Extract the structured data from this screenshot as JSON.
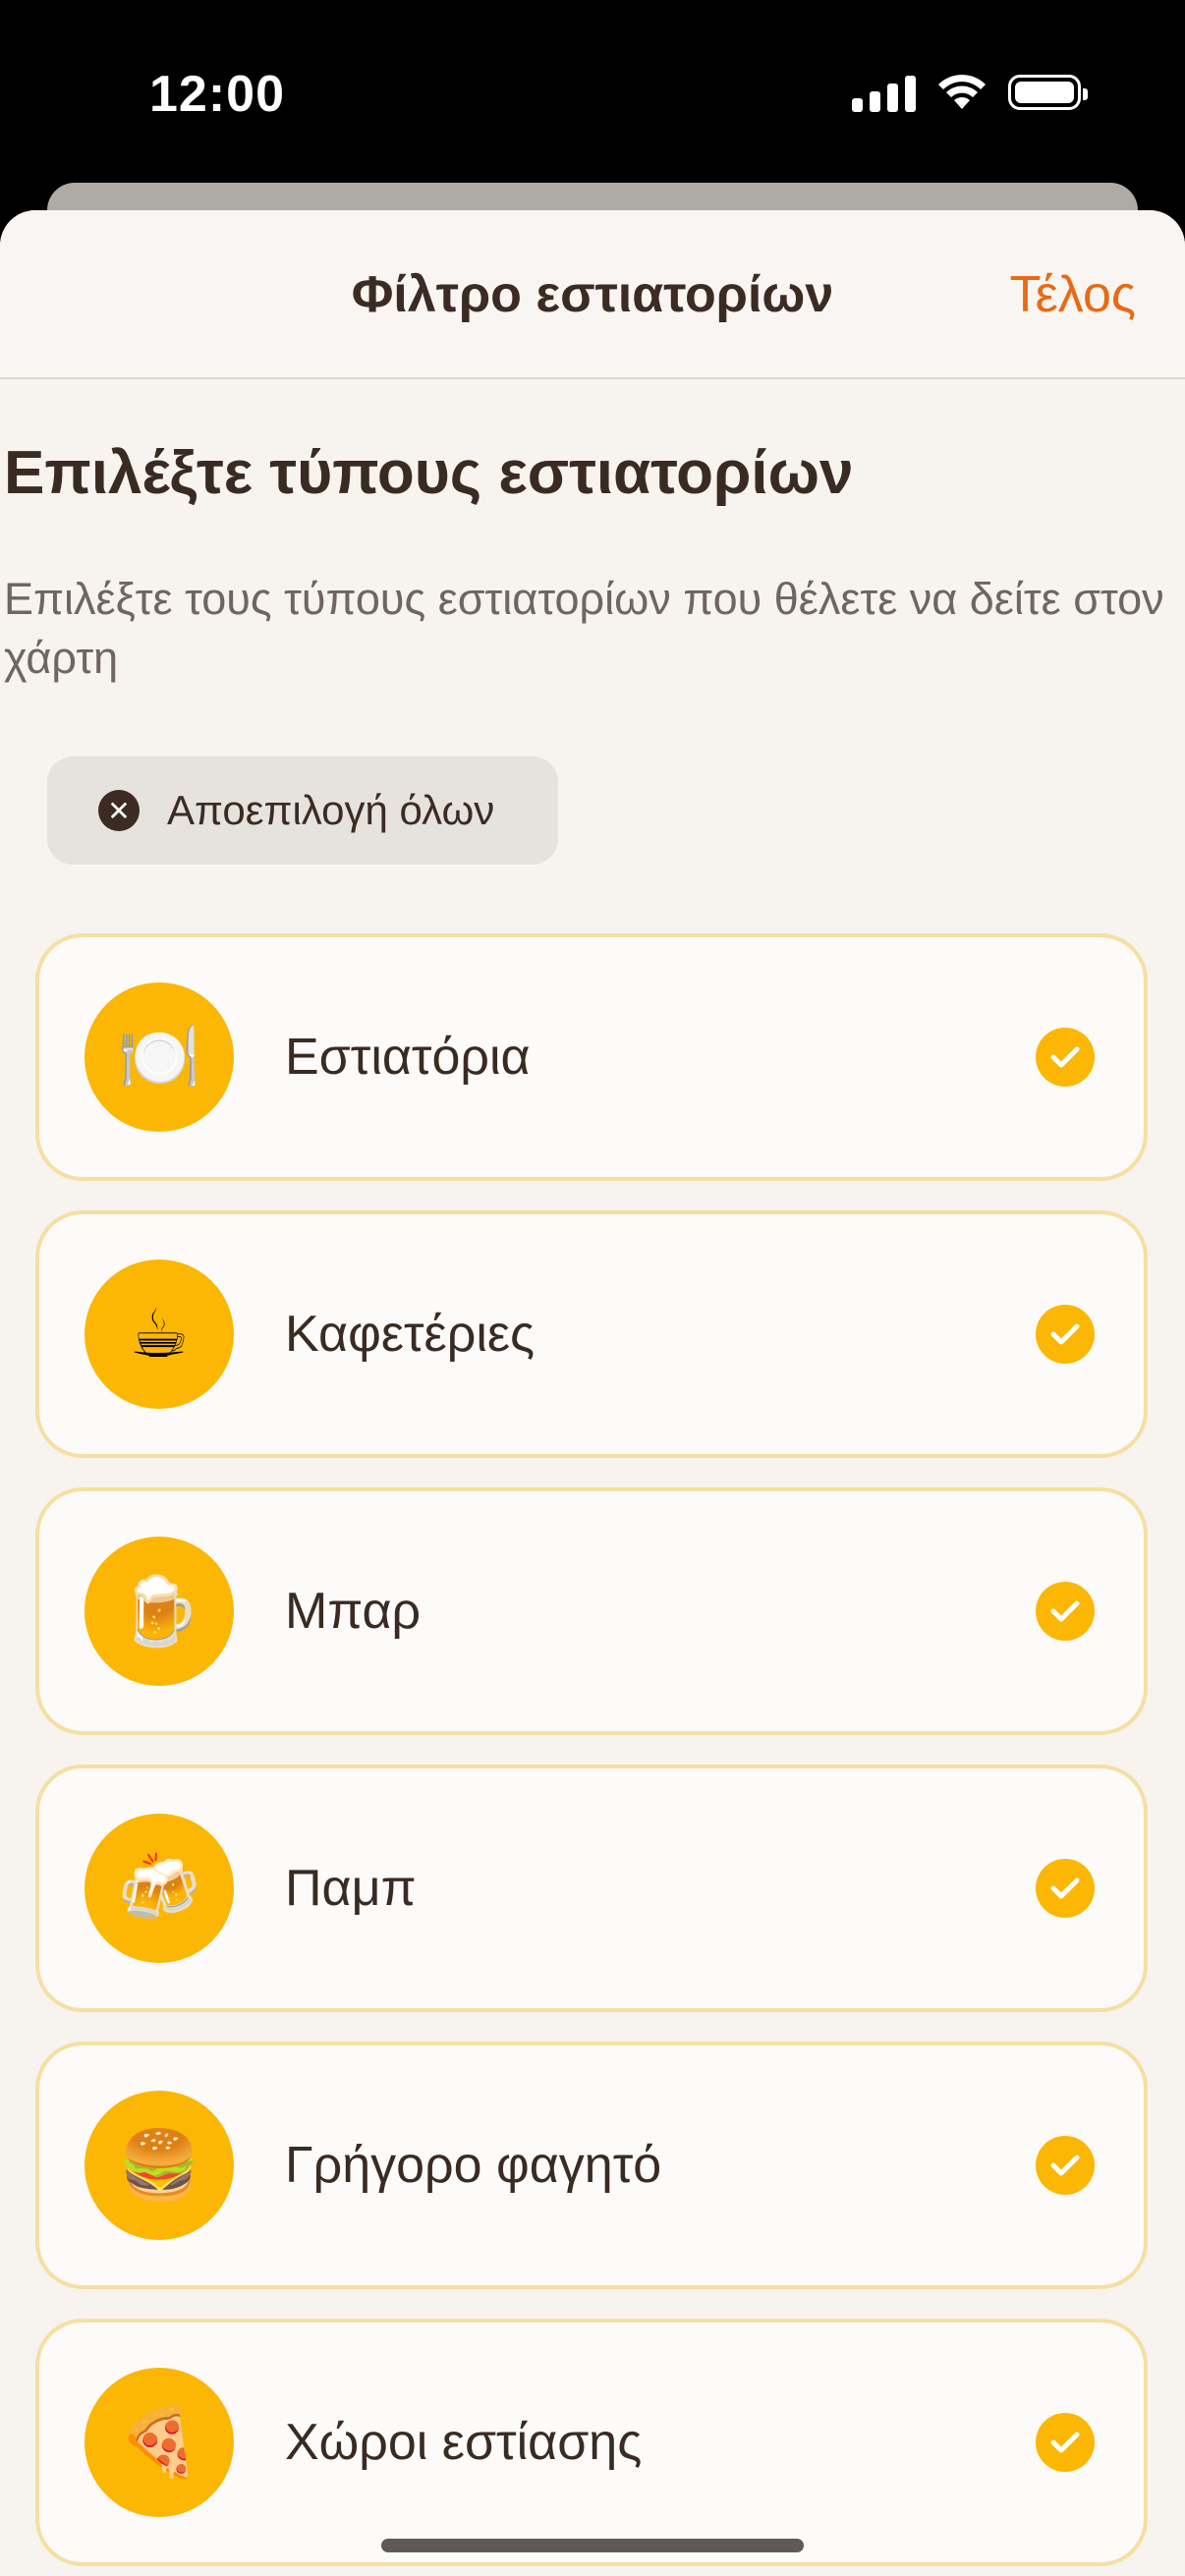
{
  "status_bar": {
    "time": "12:00",
    "signal_icon": "cellular-signal-icon",
    "wifi_icon": "wifi-icon",
    "battery_icon": "battery-icon",
    "battery_level": 1.0
  },
  "nav": {
    "title": "Φίλτρο εστιατορίων",
    "done_label": "Τέλος"
  },
  "main": {
    "heading": "Επιλέξτε τύπους εστιατορίων",
    "subtitle": "Επιλέξτε τους τύπους εστιατορίων που θέλετε να δείτε στον χάρτη",
    "deselect_all_label": "Αποεπιλογή όλων",
    "deselect_icon": "close-circle-icon"
  },
  "categories": [
    {
      "label": "Εστιατόρια",
      "emoji": "🍽️",
      "icon": "fork-knife-plate-icon",
      "selected": true
    },
    {
      "label": "Καφετέριες",
      "emoji": "☕",
      "icon": "coffee-cup-icon",
      "selected": true
    },
    {
      "label": "Μπαρ",
      "emoji": "🍺",
      "icon": "beer-mug-icon",
      "selected": true
    },
    {
      "label": "Παμπ",
      "emoji": "🍻",
      "icon": "clinking-beers-icon",
      "selected": true
    },
    {
      "label": "Γρήγορο φαγητό",
      "emoji": "🍔",
      "icon": "burger-icon",
      "selected": true
    },
    {
      "label": "Χώροι εστίασης",
      "emoji": "🍕",
      "icon": "pizza-icon",
      "selected": true
    }
  ],
  "colors": {
    "accent": "#e86a12",
    "icon_background": "#fbb704",
    "card_border": "#f6dfa2",
    "sheet_background": "#f7f3ef",
    "text_primary": "#3a2b22"
  }
}
